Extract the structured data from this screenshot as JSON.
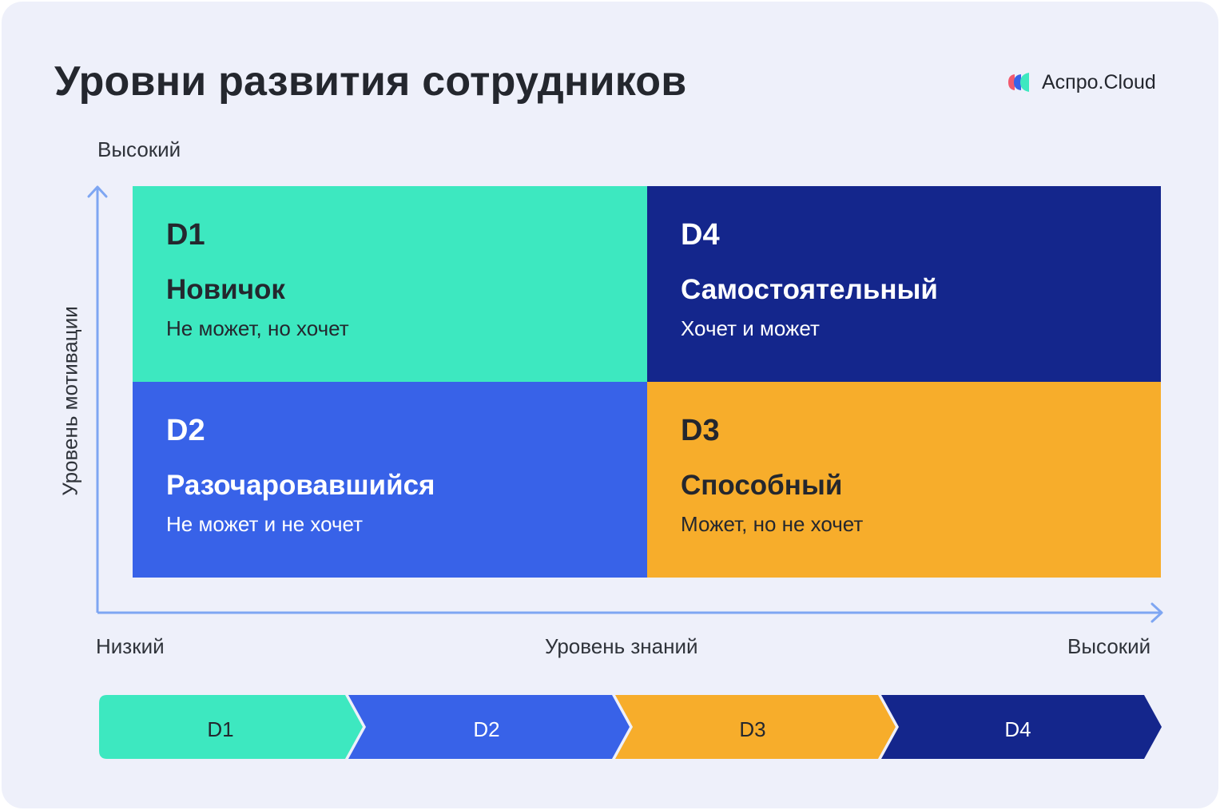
{
  "title": "Уровни развития сотрудников",
  "logo": {
    "text": "Аспро.Cloud",
    "icon": "aspro-cloud-logo-icon"
  },
  "y_axis": {
    "title": "Уровень мотивации",
    "high_label": "Высокий"
  },
  "x_axis": {
    "title": "Уровень знаний",
    "low_label": "Низкий",
    "high_label": "Высокий"
  },
  "quadrants": {
    "top_left": {
      "code": "D1",
      "name": "Новичок",
      "desc": "Не может, но хочет",
      "color": "#3de8c0"
    },
    "top_right": {
      "code": "D4",
      "name": "Самостоятельный",
      "desc": "Хочет и может",
      "color": "#14268c"
    },
    "bottom_left": {
      "code": "D2",
      "name": "Разочаровавшийся",
      "desc": "Не может и не хочет",
      "color": "#3862e8"
    },
    "bottom_right": {
      "code": "D3",
      "name": "Способный",
      "desc": "Может, но не хочет",
      "color": "#f7ad2b"
    }
  },
  "stages": [
    {
      "label": "D1",
      "color": "#3de8c0"
    },
    {
      "label": "D2",
      "color": "#3862e8"
    },
    {
      "label": "D3",
      "color": "#f7ad2b"
    },
    {
      "label": "D4",
      "color": "#14268c"
    }
  ],
  "axis_color": "#7ea6f2"
}
